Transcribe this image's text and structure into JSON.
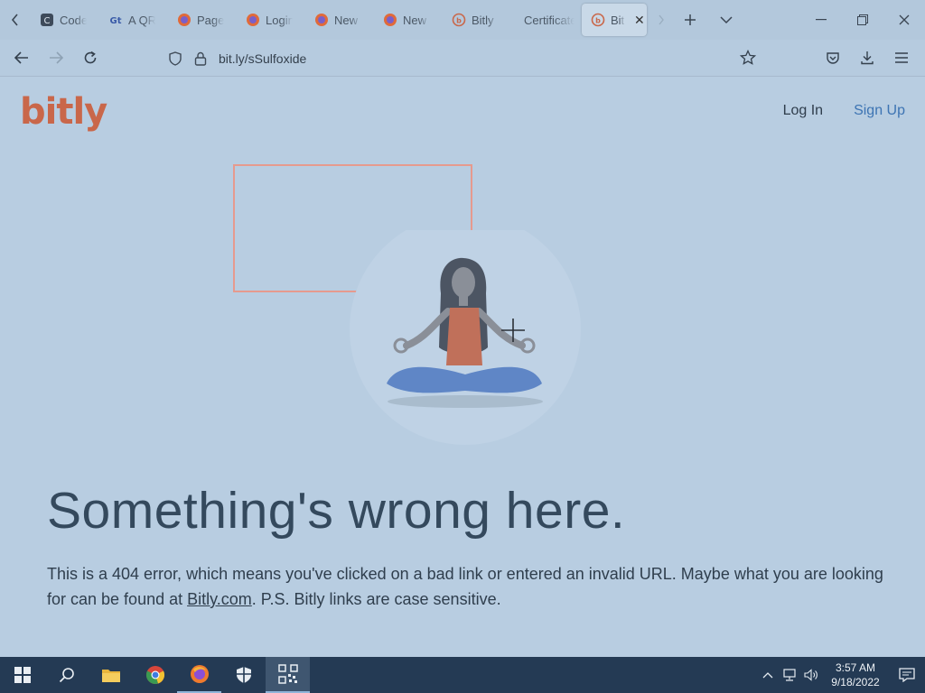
{
  "browser": {
    "tabs": [
      {
        "label": "Code",
        "icon": "codepen-icon"
      },
      {
        "label": "A QR",
        "icon": "qr-generator-icon"
      },
      {
        "label": "Page",
        "icon": "firefox-icon"
      },
      {
        "label": "Login",
        "icon": "firefox-icon"
      },
      {
        "label": "New",
        "icon": "firefox-icon"
      },
      {
        "label": "New",
        "icon": "firefox-icon"
      },
      {
        "label": "Bitly",
        "icon": "bitly-icon"
      },
      {
        "label": "Certificate",
        "icon": "none"
      },
      {
        "label": "Bit",
        "icon": "bitly-icon",
        "active": true
      }
    ],
    "url": "bit.ly/sSulfoxide"
  },
  "page": {
    "logo": "bitly",
    "nav": {
      "login": "Log In",
      "signup": "Sign Up"
    },
    "headline": "Something's wrong here.",
    "body_prefix": "This is a 404 error, which means you've clicked on a bad link or entered an invalid URL. Maybe what you are looking for can be found at ",
    "body_link": "Bitly.com",
    "body_suffix": ". P.S. Bitly links are case sensitive."
  },
  "taskbar": {
    "time": "3:57 AM",
    "date": "9/18/2022"
  },
  "colors": {
    "brand": "#c9674a",
    "signup": "#3d74b3",
    "background": "#b8cde1",
    "selection": "#e69a8e"
  }
}
